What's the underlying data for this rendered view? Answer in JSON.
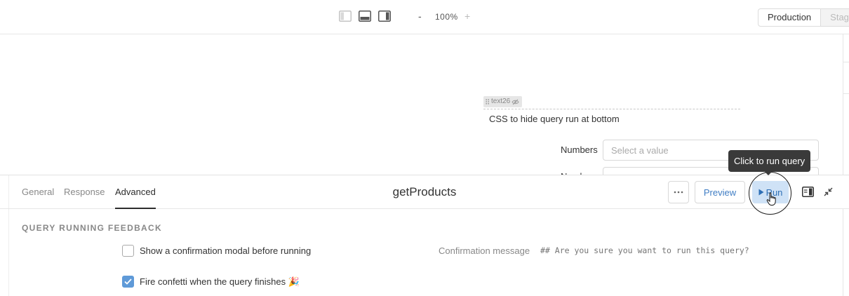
{
  "toolbar": {
    "layout_icons": [
      "left-panel-icon",
      "bottom-panel-icon",
      "right-panel-icon"
    ],
    "zoom_minus": "-",
    "zoom_level": "100%",
    "zoom_plus": "+",
    "environments": [
      "Production",
      "Stagi"
    ]
  },
  "canvas": {
    "component_tag": "text26",
    "component_text": "CSS to hide query run at bottom",
    "numbers_label": "Numbers",
    "numbers_placeholder": "Select a value",
    "second_label": "Numb"
  },
  "query_panel": {
    "tabs": [
      {
        "label": "General"
      },
      {
        "label": "Response"
      },
      {
        "label": "Advanced"
      }
    ],
    "active_tab": "Advanced",
    "query_name": "getProducts",
    "more_label": "···",
    "preview_label": "Preview",
    "run_label": "Run",
    "tooltip": "Click to run query",
    "section_title": "QUERY RUNNING FEEDBACK",
    "options": [
      {
        "label": "Show a confirmation modal before running",
        "checked": false
      },
      {
        "label": "Fire confetti when the query finishes 🎉",
        "checked": true
      }
    ],
    "confirmation_label": "Confirmation message",
    "confirmation_placeholder": "## Are you sure you want to run this query?"
  },
  "colors": {
    "accent": "#3f7dc4",
    "run_bg": "#cfe2f6",
    "checkbox_checked": "#5f9ad8",
    "tooltip_bg": "#3a3a3a"
  }
}
